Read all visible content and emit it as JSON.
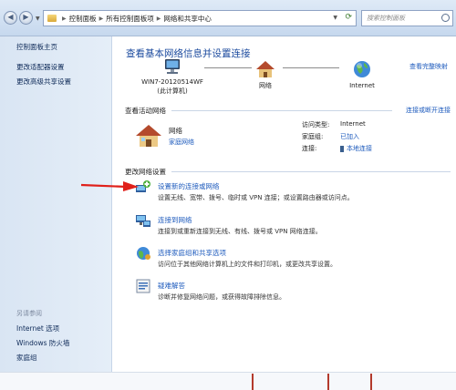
{
  "address": {
    "crumbs": [
      "控制面板",
      "所有控制面板项",
      "网络和共享中心"
    ],
    "search_placeholder": "搜索控制面板"
  },
  "sidebar": {
    "home": "控制面板主页",
    "links": [
      "更改适配器设置",
      "更改高级共享设置"
    ],
    "see_also_heading": "另请参阅",
    "see_also": [
      "Internet 选项",
      "Windows 防火墙",
      "家庭组"
    ]
  },
  "main": {
    "title": "查看基本网络信息并设置连接",
    "full_map": "查看完整映射",
    "map": {
      "computer_name": "WIN7-20120514WF",
      "computer_sub": "(此计算机)",
      "network_label": "网络",
      "internet_label": "Internet"
    },
    "active_heading": "查看活动网络",
    "connect_disconnect": "连接或断开连接",
    "active_network": {
      "name": "网络",
      "type": "家庭网络",
      "access_type_label": "访问类型:",
      "access_type_value": "Internet",
      "homegroup_label": "家庭组:",
      "homegroup_value": "已加入",
      "connections_label": "连接:",
      "connections_value": "本地连接"
    },
    "change_heading": "更改网络设置",
    "tasks": [
      {
        "title": "设置新的连接或网络",
        "desc": "设置无线、宽带、拨号、临时或 VPN 连接；或设置路由器或访问点。"
      },
      {
        "title": "连接到网络",
        "desc": "连接到或重新连接到无线、有线、拨号或 VPN 网络连接。"
      },
      {
        "title": "选择家庭组和共享选项",
        "desc": "访问位于其他网络计算机上的文件和打印机，或更改共享设置。"
      },
      {
        "title": "疑难解答",
        "desc": "诊断并修复网络问题，或获得故障排除信息。"
      }
    ]
  },
  "colors": {
    "link": "#1e5bbd",
    "title": "#1b4a9e",
    "sidebar_bg": "#dde8f5",
    "annotation_arrow": "#e0201a"
  }
}
